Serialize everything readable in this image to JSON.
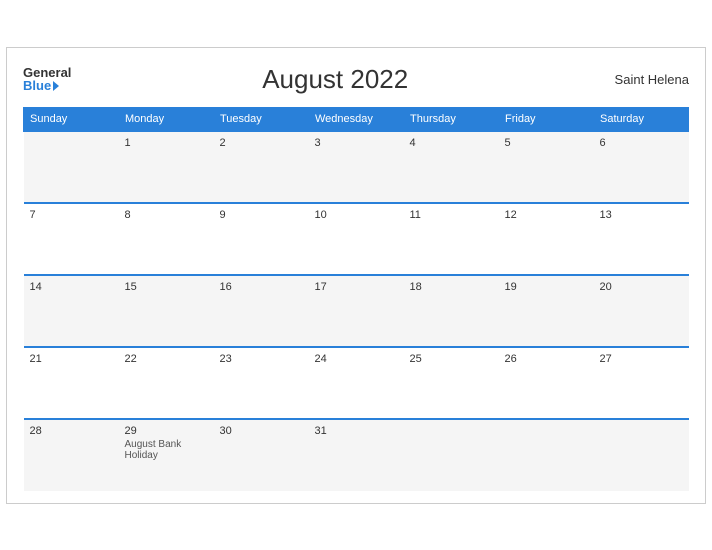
{
  "header": {
    "logo_general": "General",
    "logo_blue": "Blue",
    "title": "August 2022",
    "region": "Saint Helena"
  },
  "weekdays": [
    "Sunday",
    "Monday",
    "Tuesday",
    "Wednesday",
    "Thursday",
    "Friday",
    "Saturday"
  ],
  "weeks": [
    [
      {
        "day": "",
        "event": ""
      },
      {
        "day": "1",
        "event": ""
      },
      {
        "day": "2",
        "event": ""
      },
      {
        "day": "3",
        "event": ""
      },
      {
        "day": "4",
        "event": ""
      },
      {
        "day": "5",
        "event": ""
      },
      {
        "day": "6",
        "event": ""
      }
    ],
    [
      {
        "day": "7",
        "event": ""
      },
      {
        "day": "8",
        "event": ""
      },
      {
        "day": "9",
        "event": ""
      },
      {
        "day": "10",
        "event": ""
      },
      {
        "day": "11",
        "event": ""
      },
      {
        "day": "12",
        "event": ""
      },
      {
        "day": "13",
        "event": ""
      }
    ],
    [
      {
        "day": "14",
        "event": ""
      },
      {
        "day": "15",
        "event": ""
      },
      {
        "day": "16",
        "event": ""
      },
      {
        "day": "17",
        "event": ""
      },
      {
        "day": "18",
        "event": ""
      },
      {
        "day": "19",
        "event": ""
      },
      {
        "day": "20",
        "event": ""
      }
    ],
    [
      {
        "day": "21",
        "event": ""
      },
      {
        "day": "22",
        "event": ""
      },
      {
        "day": "23",
        "event": ""
      },
      {
        "day": "24",
        "event": ""
      },
      {
        "day": "25",
        "event": ""
      },
      {
        "day": "26",
        "event": ""
      },
      {
        "day": "27",
        "event": ""
      }
    ],
    [
      {
        "day": "28",
        "event": ""
      },
      {
        "day": "29",
        "event": "August Bank Holiday"
      },
      {
        "day": "30",
        "event": ""
      },
      {
        "day": "31",
        "event": ""
      },
      {
        "day": "",
        "event": ""
      },
      {
        "day": "",
        "event": ""
      },
      {
        "day": "",
        "event": ""
      }
    ]
  ]
}
